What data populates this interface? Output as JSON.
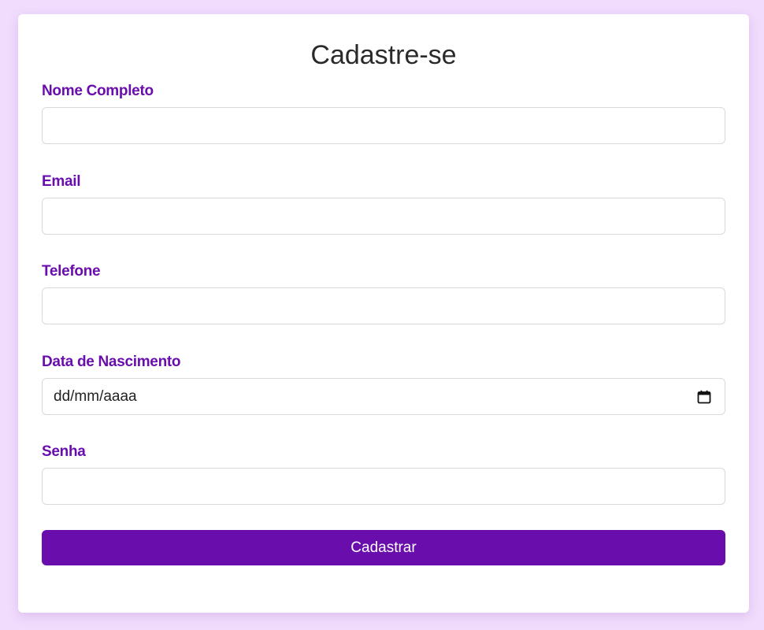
{
  "page": {
    "title": "Cadastre-se",
    "accent_color": "#6a0dad",
    "background_color": "#f1dcfd"
  },
  "form": {
    "fields": [
      {
        "label": "Nome Completo",
        "value": "",
        "type": "text"
      },
      {
        "label": "Email",
        "value": "",
        "type": "email"
      },
      {
        "label": "Telefone",
        "value": "",
        "type": "tel"
      },
      {
        "label": "Data de Nascimento",
        "value": "dd/mm/aaaa",
        "type": "date",
        "icon": "calendar-icon"
      },
      {
        "label": "Senha",
        "value": "",
        "type": "password"
      }
    ],
    "submit_label": "Cadastrar"
  }
}
